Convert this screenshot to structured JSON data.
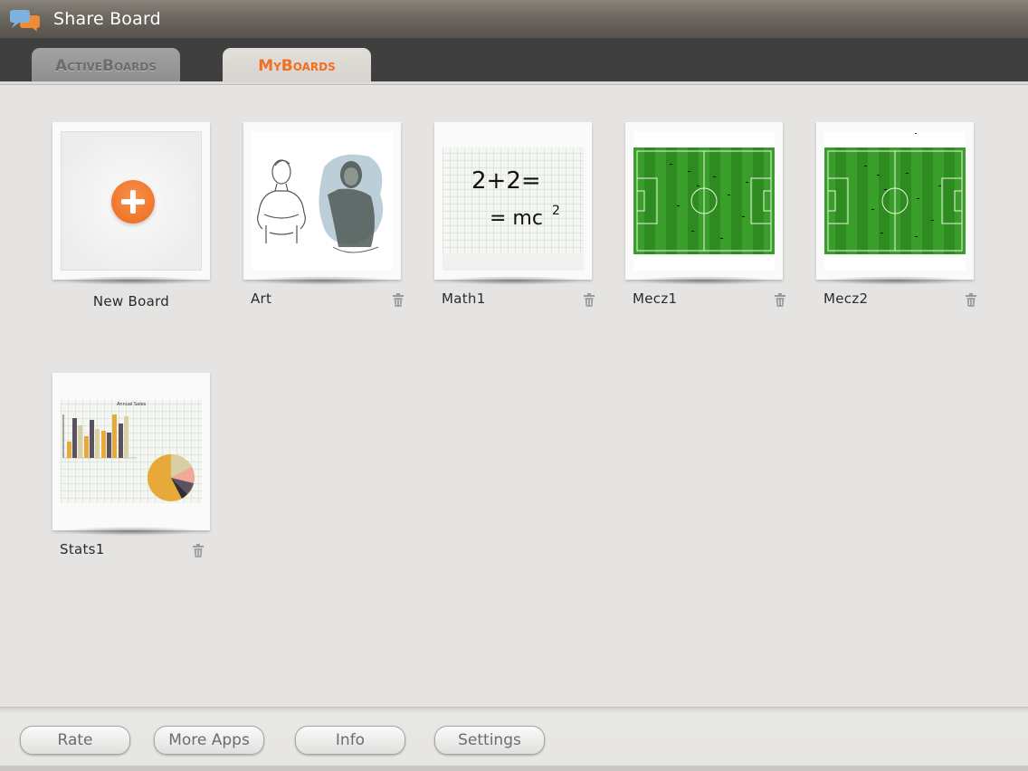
{
  "app": {
    "title": "Share Board"
  },
  "tabs": [
    {
      "label": "ActiveBoards",
      "selected": false
    },
    {
      "label": "MyBoards",
      "selected": true
    }
  ],
  "new_board": {
    "label": "New Board"
  },
  "boards": [
    {
      "label": "Art",
      "thumbnail": "sketch-portraits"
    },
    {
      "label": "Math1",
      "thumbnail": "equations",
      "text": [
        "2+2=",
        "= mc",
        "2"
      ]
    },
    {
      "label": "Mecz1",
      "thumbnail": "football-pitch"
    },
    {
      "label": "Mecz2",
      "thumbnail": "football-pitch"
    },
    {
      "label": "Stats1",
      "thumbnail": "charts",
      "chart_title": "Annual Sales"
    }
  ],
  "footer": {
    "buttons": [
      "Rate",
      "More Apps",
      "Info",
      "Settings"
    ]
  },
  "colors": {
    "accent": "#f26f21",
    "pitch_green": "#2e8b1f",
    "tab_bar": "#3f3f3f"
  }
}
